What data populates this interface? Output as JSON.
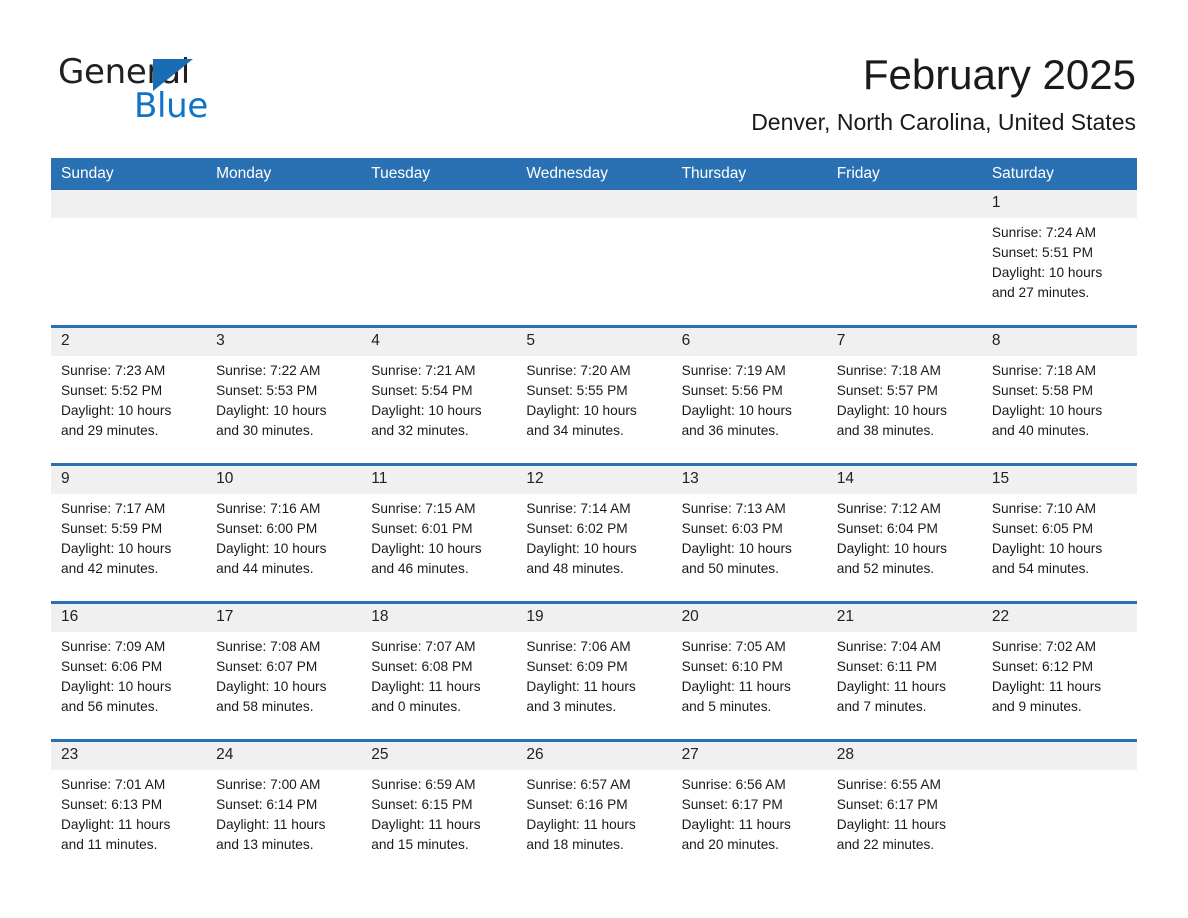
{
  "brand": {
    "name_dark": "General",
    "name_light": "Blue",
    "logo_icon": "triangle-logo-icon",
    "accent_color": "#1a6cb3",
    "text_color": "#0f74c8"
  },
  "header": {
    "title": "February 2025",
    "subtitle": "Denver, North Carolina, United States"
  },
  "calendar": {
    "header_bg": "#2a71b3",
    "daynum_bg": "#f0f0f0",
    "row_divider_color": "#2a71b3",
    "weekdays": [
      "Sunday",
      "Monday",
      "Tuesday",
      "Wednesday",
      "Thursday",
      "Friday",
      "Saturday"
    ],
    "weeks": [
      [
        {
          "day": "",
          "empty": true
        },
        {
          "day": "",
          "empty": true
        },
        {
          "day": "",
          "empty": true
        },
        {
          "day": "",
          "empty": true
        },
        {
          "day": "",
          "empty": true
        },
        {
          "day": "",
          "empty": true
        },
        {
          "day": "1",
          "sunrise": "Sunrise: 7:24 AM",
          "sunset": "Sunset: 5:51 PM",
          "daylight1": "Daylight: 10 hours",
          "daylight2": "and 27 minutes."
        }
      ],
      [
        {
          "day": "2",
          "sunrise": "Sunrise: 7:23 AM",
          "sunset": "Sunset: 5:52 PM",
          "daylight1": "Daylight: 10 hours",
          "daylight2": "and 29 minutes."
        },
        {
          "day": "3",
          "sunrise": "Sunrise: 7:22 AM",
          "sunset": "Sunset: 5:53 PM",
          "daylight1": "Daylight: 10 hours",
          "daylight2": "and 30 minutes."
        },
        {
          "day": "4",
          "sunrise": "Sunrise: 7:21 AM",
          "sunset": "Sunset: 5:54 PM",
          "daylight1": "Daylight: 10 hours",
          "daylight2": "and 32 minutes."
        },
        {
          "day": "5",
          "sunrise": "Sunrise: 7:20 AM",
          "sunset": "Sunset: 5:55 PM",
          "daylight1": "Daylight: 10 hours",
          "daylight2": "and 34 minutes."
        },
        {
          "day": "6",
          "sunrise": "Sunrise: 7:19 AM",
          "sunset": "Sunset: 5:56 PM",
          "daylight1": "Daylight: 10 hours",
          "daylight2": "and 36 minutes."
        },
        {
          "day": "7",
          "sunrise": "Sunrise: 7:18 AM",
          "sunset": "Sunset: 5:57 PM",
          "daylight1": "Daylight: 10 hours",
          "daylight2": "and 38 minutes."
        },
        {
          "day": "8",
          "sunrise": "Sunrise: 7:18 AM",
          "sunset": "Sunset: 5:58 PM",
          "daylight1": "Daylight: 10 hours",
          "daylight2": "and 40 minutes."
        }
      ],
      [
        {
          "day": "9",
          "sunrise": "Sunrise: 7:17 AM",
          "sunset": "Sunset: 5:59 PM",
          "daylight1": "Daylight: 10 hours",
          "daylight2": "and 42 minutes."
        },
        {
          "day": "10",
          "sunrise": "Sunrise: 7:16 AM",
          "sunset": "Sunset: 6:00 PM",
          "daylight1": "Daylight: 10 hours",
          "daylight2": "and 44 minutes."
        },
        {
          "day": "11",
          "sunrise": "Sunrise: 7:15 AM",
          "sunset": "Sunset: 6:01 PM",
          "daylight1": "Daylight: 10 hours",
          "daylight2": "and 46 minutes."
        },
        {
          "day": "12",
          "sunrise": "Sunrise: 7:14 AM",
          "sunset": "Sunset: 6:02 PM",
          "daylight1": "Daylight: 10 hours",
          "daylight2": "and 48 minutes."
        },
        {
          "day": "13",
          "sunrise": "Sunrise: 7:13 AM",
          "sunset": "Sunset: 6:03 PM",
          "daylight1": "Daylight: 10 hours",
          "daylight2": "and 50 minutes."
        },
        {
          "day": "14",
          "sunrise": "Sunrise: 7:12 AM",
          "sunset": "Sunset: 6:04 PM",
          "daylight1": "Daylight: 10 hours",
          "daylight2": "and 52 minutes."
        },
        {
          "day": "15",
          "sunrise": "Sunrise: 7:10 AM",
          "sunset": "Sunset: 6:05 PM",
          "daylight1": "Daylight: 10 hours",
          "daylight2": "and 54 minutes."
        }
      ],
      [
        {
          "day": "16",
          "sunrise": "Sunrise: 7:09 AM",
          "sunset": "Sunset: 6:06 PM",
          "daylight1": "Daylight: 10 hours",
          "daylight2": "and 56 minutes."
        },
        {
          "day": "17",
          "sunrise": "Sunrise: 7:08 AM",
          "sunset": "Sunset: 6:07 PM",
          "daylight1": "Daylight: 10 hours",
          "daylight2": "and 58 minutes."
        },
        {
          "day": "18",
          "sunrise": "Sunrise: 7:07 AM",
          "sunset": "Sunset: 6:08 PM",
          "daylight1": "Daylight: 11 hours",
          "daylight2": "and 0 minutes."
        },
        {
          "day": "19",
          "sunrise": "Sunrise: 7:06 AM",
          "sunset": "Sunset: 6:09 PM",
          "daylight1": "Daylight: 11 hours",
          "daylight2": "and 3 minutes."
        },
        {
          "day": "20",
          "sunrise": "Sunrise: 7:05 AM",
          "sunset": "Sunset: 6:10 PM",
          "daylight1": "Daylight: 11 hours",
          "daylight2": "and 5 minutes."
        },
        {
          "day": "21",
          "sunrise": "Sunrise: 7:04 AM",
          "sunset": "Sunset: 6:11 PM",
          "daylight1": "Daylight: 11 hours",
          "daylight2": "and 7 minutes."
        },
        {
          "day": "22",
          "sunrise": "Sunrise: 7:02 AM",
          "sunset": "Sunset: 6:12 PM",
          "daylight1": "Daylight: 11 hours",
          "daylight2": "and 9 minutes."
        }
      ],
      [
        {
          "day": "23",
          "sunrise": "Sunrise: 7:01 AM",
          "sunset": "Sunset: 6:13 PM",
          "daylight1": "Daylight: 11 hours",
          "daylight2": "and 11 minutes."
        },
        {
          "day": "24",
          "sunrise": "Sunrise: 7:00 AM",
          "sunset": "Sunset: 6:14 PM",
          "daylight1": "Daylight: 11 hours",
          "daylight2": "and 13 minutes."
        },
        {
          "day": "25",
          "sunrise": "Sunrise: 6:59 AM",
          "sunset": "Sunset: 6:15 PM",
          "daylight1": "Daylight: 11 hours",
          "daylight2": "and 15 minutes."
        },
        {
          "day": "26",
          "sunrise": "Sunrise: 6:57 AM",
          "sunset": "Sunset: 6:16 PM",
          "daylight1": "Daylight: 11 hours",
          "daylight2": "and 18 minutes."
        },
        {
          "day": "27",
          "sunrise": "Sunrise: 6:56 AM",
          "sunset": "Sunset: 6:17 PM",
          "daylight1": "Daylight: 11 hours",
          "daylight2": "and 20 minutes."
        },
        {
          "day": "28",
          "sunrise": "Sunrise: 6:55 AM",
          "sunset": "Sunset: 6:17 PM",
          "daylight1": "Daylight: 11 hours",
          "daylight2": "and 22 minutes."
        },
        {
          "day": "",
          "empty": true
        }
      ]
    ]
  }
}
